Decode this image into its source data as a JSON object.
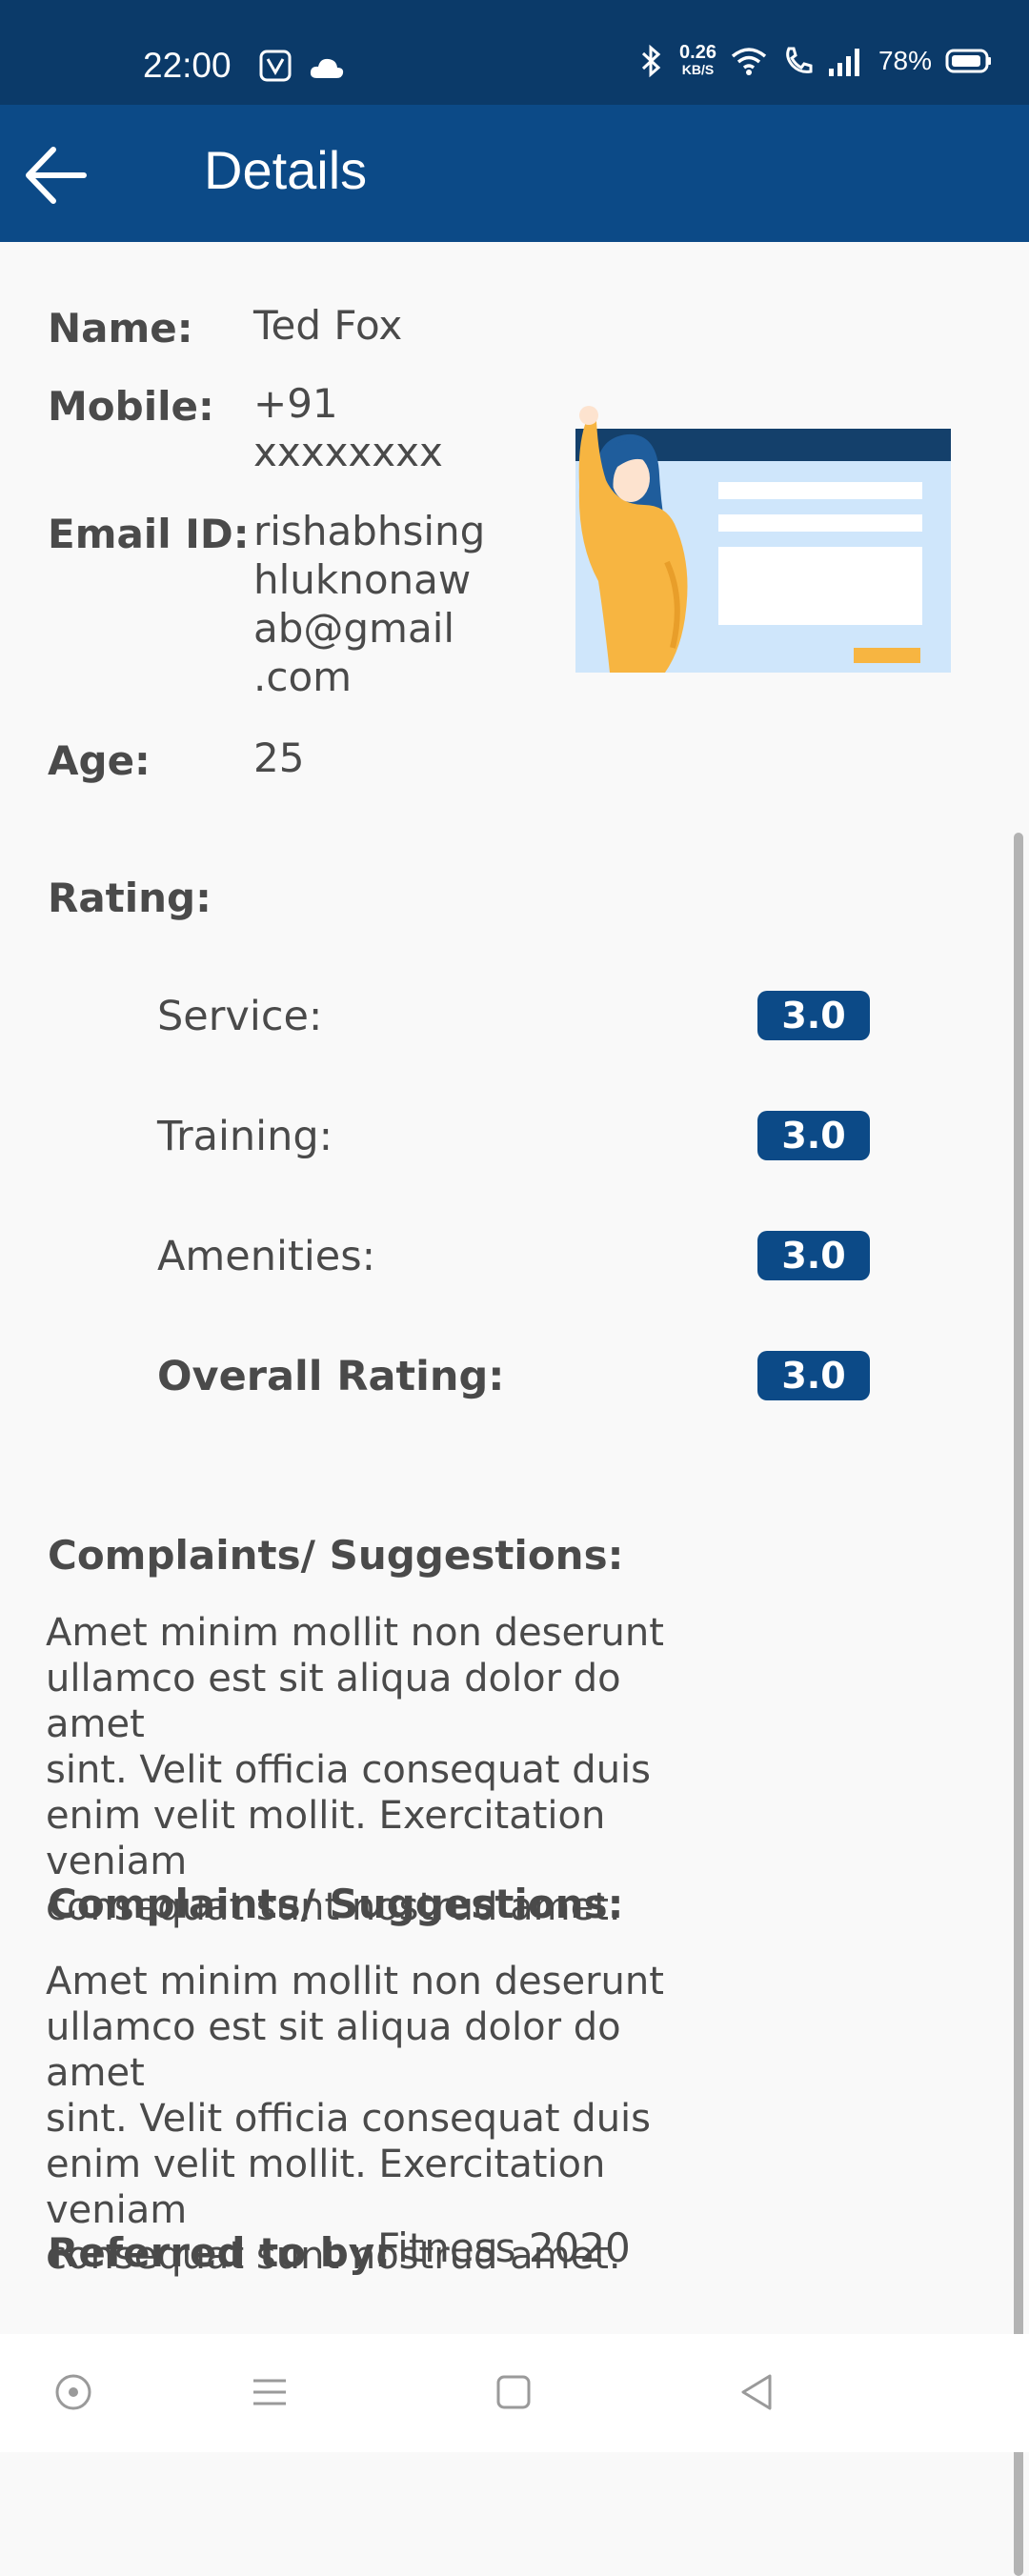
{
  "status_bar": {
    "time": "22:00",
    "net_speed_value": "0.26",
    "net_speed_unit": "KB/S",
    "battery_percent": "78%"
  },
  "app_bar": {
    "title": "Details"
  },
  "profile": {
    "name_label": "Name:",
    "name_value": "Ted Fox",
    "mobile_label": "Mobile:",
    "mobile_line1": "+91",
    "mobile_line2": "xxxxxxxx",
    "email_label": "Email ID:",
    "email_line1": "rishabhsing",
    "email_line2": "hluknonaw",
    "email_line3": "ab@gmail",
    "email_line4": ".com",
    "age_label": "Age:",
    "age_value": "25"
  },
  "rating": {
    "heading": "Rating:",
    "items": [
      {
        "label": "Service:",
        "value": "3.0"
      },
      {
        "label": "Training:",
        "value": "3.0"
      },
      {
        "label": "Amenities:",
        "value": "3.0"
      },
      {
        "label": "Overall Rating:",
        "value": "3.0"
      }
    ]
  },
  "feedback": [
    {
      "heading": "Complaints/ Suggestions:",
      "line1": "Amet minim mollit non deserunt",
      "line2": "ullamco est sit aliqua dolor do amet",
      "line3": "sint. Velit officia consequat duis",
      "line4": "enim velit mollit. Exercitation veniam",
      "line5": "consequat sunt nostrud amet."
    },
    {
      "heading": "Complaints/ Suggestions:",
      "line1": "Amet minim mollit non deserunt",
      "line2": "ullamco est sit aliqua dolor do amet",
      "line3": "sint. Velit officia consequat duis",
      "line4": "enim velit mollit. Exercitation veniam",
      "line5": "consequat sunt nostrud amet."
    }
  ],
  "referral": {
    "label": "Referred to by:",
    "value": "Fitness 2020"
  },
  "colors": {
    "status_bar": "#0b3a69",
    "app_bar": "#0c4a87",
    "badge": "#0c4a87",
    "background": "#f9f9f9",
    "text": "#4a4a4a",
    "illustration_accent": "#f7b541"
  },
  "icons": {
    "back": "arrow-left-icon",
    "nav": [
      "home-dot-icon",
      "menu-icon",
      "square-icon",
      "triangle-back-icon"
    ]
  }
}
